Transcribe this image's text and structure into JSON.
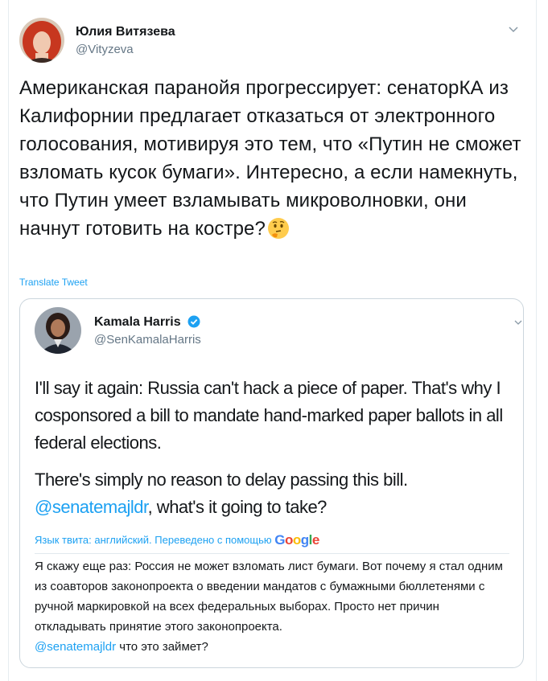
{
  "tweet": {
    "author_name": "Юлия Витязева",
    "author_handle": "@Vityzeva",
    "text": "Американская паранойя прогрессирует: сенаторКА из Калифорнии предлагает отказаться от электронного голосования, мотивируя это тем, что «Путин не сможет взломать кусок бумаги». Интересно, а если намекнуть, что Путин умеет взламывать микроволновки, они начнут готовить на костре?",
    "emoji": "thinking-face",
    "translate_label": "Translate Tweet"
  },
  "quoted": {
    "author_name": "Kamala Harris",
    "author_handle": "@SenKamalaHarris",
    "paragraph1": "I'll say it again: Russia can't hack a piece of paper. That's why I cosponsored a bill to mandate hand-marked paper ballots in all federal elections.",
    "paragraph2_start": "There's simply no reason to delay passing this bill.",
    "mention": "@senatemajldr",
    "paragraph2_end": ", what's it going to take?",
    "lang_line": "Язык твита: английский. Переведено с помощью",
    "google_label": "Google",
    "translation": "Я скажу еще раз: Россия не может взломать лист бумаги. Вот почему я стал одним из соавторов законопроекта о введении мандатов с бумажными бюллетенями с ручной маркировкой на всех федеральных выборах. Просто нет причин откладывать принятие этого законопроекта.",
    "translation_mention": "@senatemajldr",
    "translation_end": " что это займет?"
  },
  "colors": {
    "link": "#1da1f2",
    "secondary_text": "#657786",
    "border": "#ccd6dd"
  }
}
